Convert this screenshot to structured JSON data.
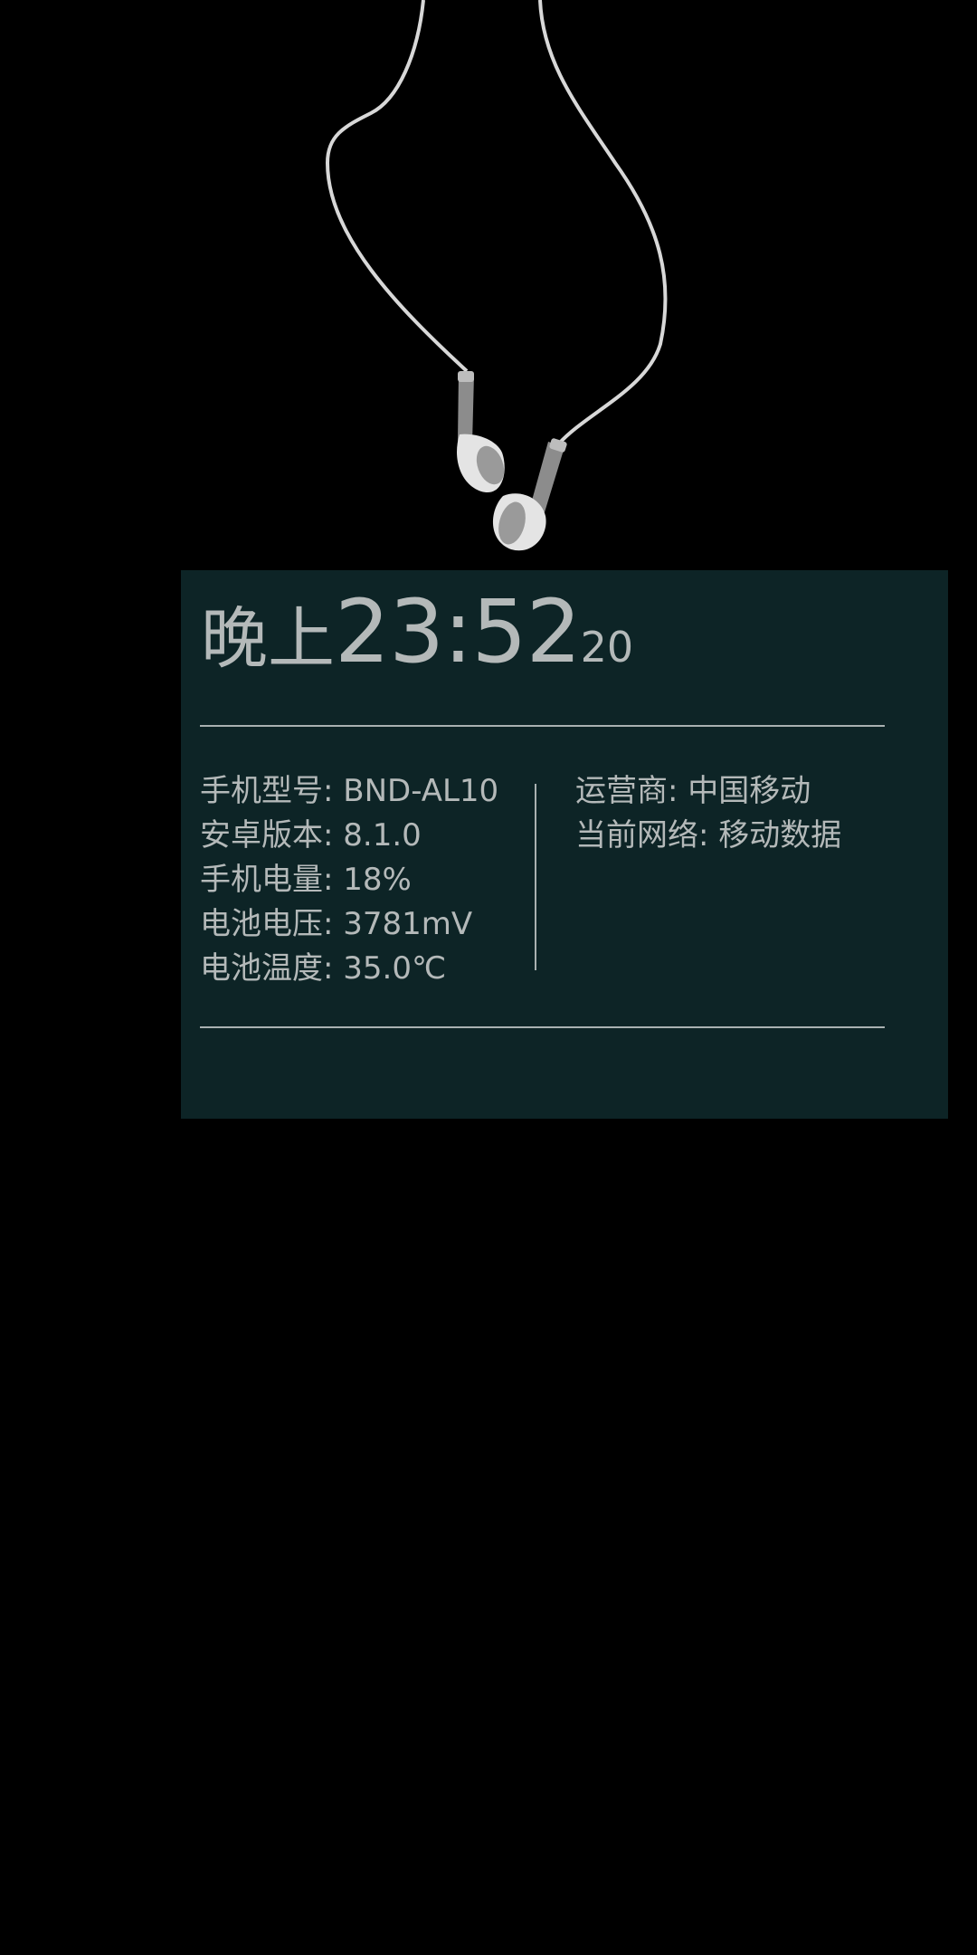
{
  "clock": {
    "period": "晚上",
    "hours_minutes": "23:52",
    "seconds": "20"
  },
  "device_info": [
    {
      "label": "手机型号",
      "value": "BND-AL10"
    },
    {
      "label": "安卓版本",
      "value": "8.1.0"
    },
    {
      "label": "手机电量",
      "value": "18%"
    },
    {
      "label": "电池电压",
      "value": "3781mV"
    },
    {
      "label": "电池温度",
      "value": "35.0℃"
    }
  ],
  "network_info": [
    {
      "label": "运营商",
      "value": "中国移动"
    },
    {
      "label": "当前网络",
      "value": "移动数据"
    }
  ],
  "colors": {
    "background": "#000000",
    "widget_background": "#0d2426",
    "text": "#b4b9b9",
    "divider": "#a9b1b1"
  },
  "icons": {
    "wallpaper": "earphones-icon"
  }
}
